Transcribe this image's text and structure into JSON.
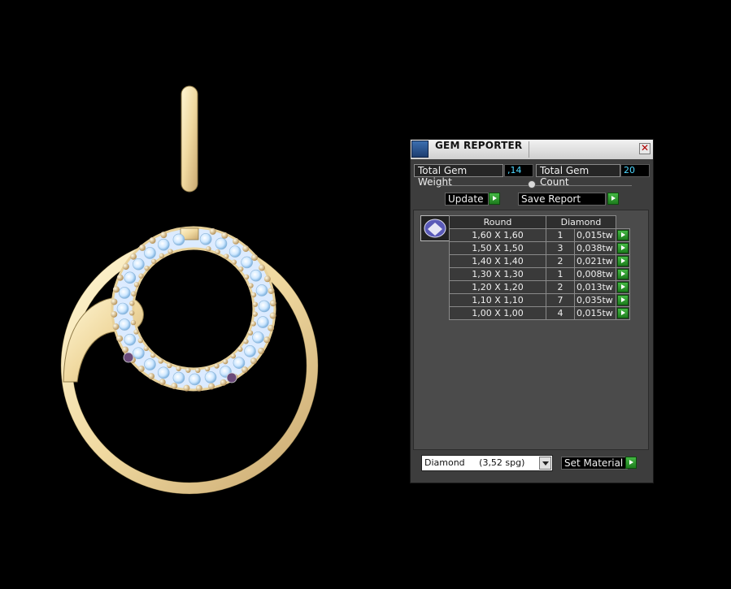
{
  "panel": {
    "title": "GEM REPORTER",
    "close_glyph": "✕",
    "total_weight_label": "Total Gem Weight",
    "total_weight_value": ",14",
    "total_count_label": "Total Gem Count",
    "total_count_value": "20",
    "update_label": "Update",
    "save_label": "Save Report",
    "table": {
      "shape_header": "Round",
      "material_header": "Diamond",
      "rows": [
        {
          "size": "1,60 X 1,60",
          "count": "1",
          "weight": "0,015tw"
        },
        {
          "size": "1,50 X 1,50",
          "count": "3",
          "weight": "0,038tw"
        },
        {
          "size": "1,40 X 1,40",
          "count": "2",
          "weight": "0,021tw"
        },
        {
          "size": "1,30 X 1,30",
          "count": "1",
          "weight": "0,008tw"
        },
        {
          "size": "1,20 X 1,20",
          "count": "2",
          "weight": "0,013tw"
        },
        {
          "size": "1,10 X 1,10",
          "count": "7",
          "weight": "0,035tw"
        },
        {
          "size": "1,00 X 1,00",
          "count": "4",
          "weight": "0,015tw"
        }
      ]
    },
    "material_select_value": "Diamond     (3,52 spg)",
    "set_material_label": "Set Material"
  },
  "colors": {
    "metal": "#f3e0ae",
    "value_text": "#4fd8ff",
    "arrow_green": "#2e9e2e"
  }
}
